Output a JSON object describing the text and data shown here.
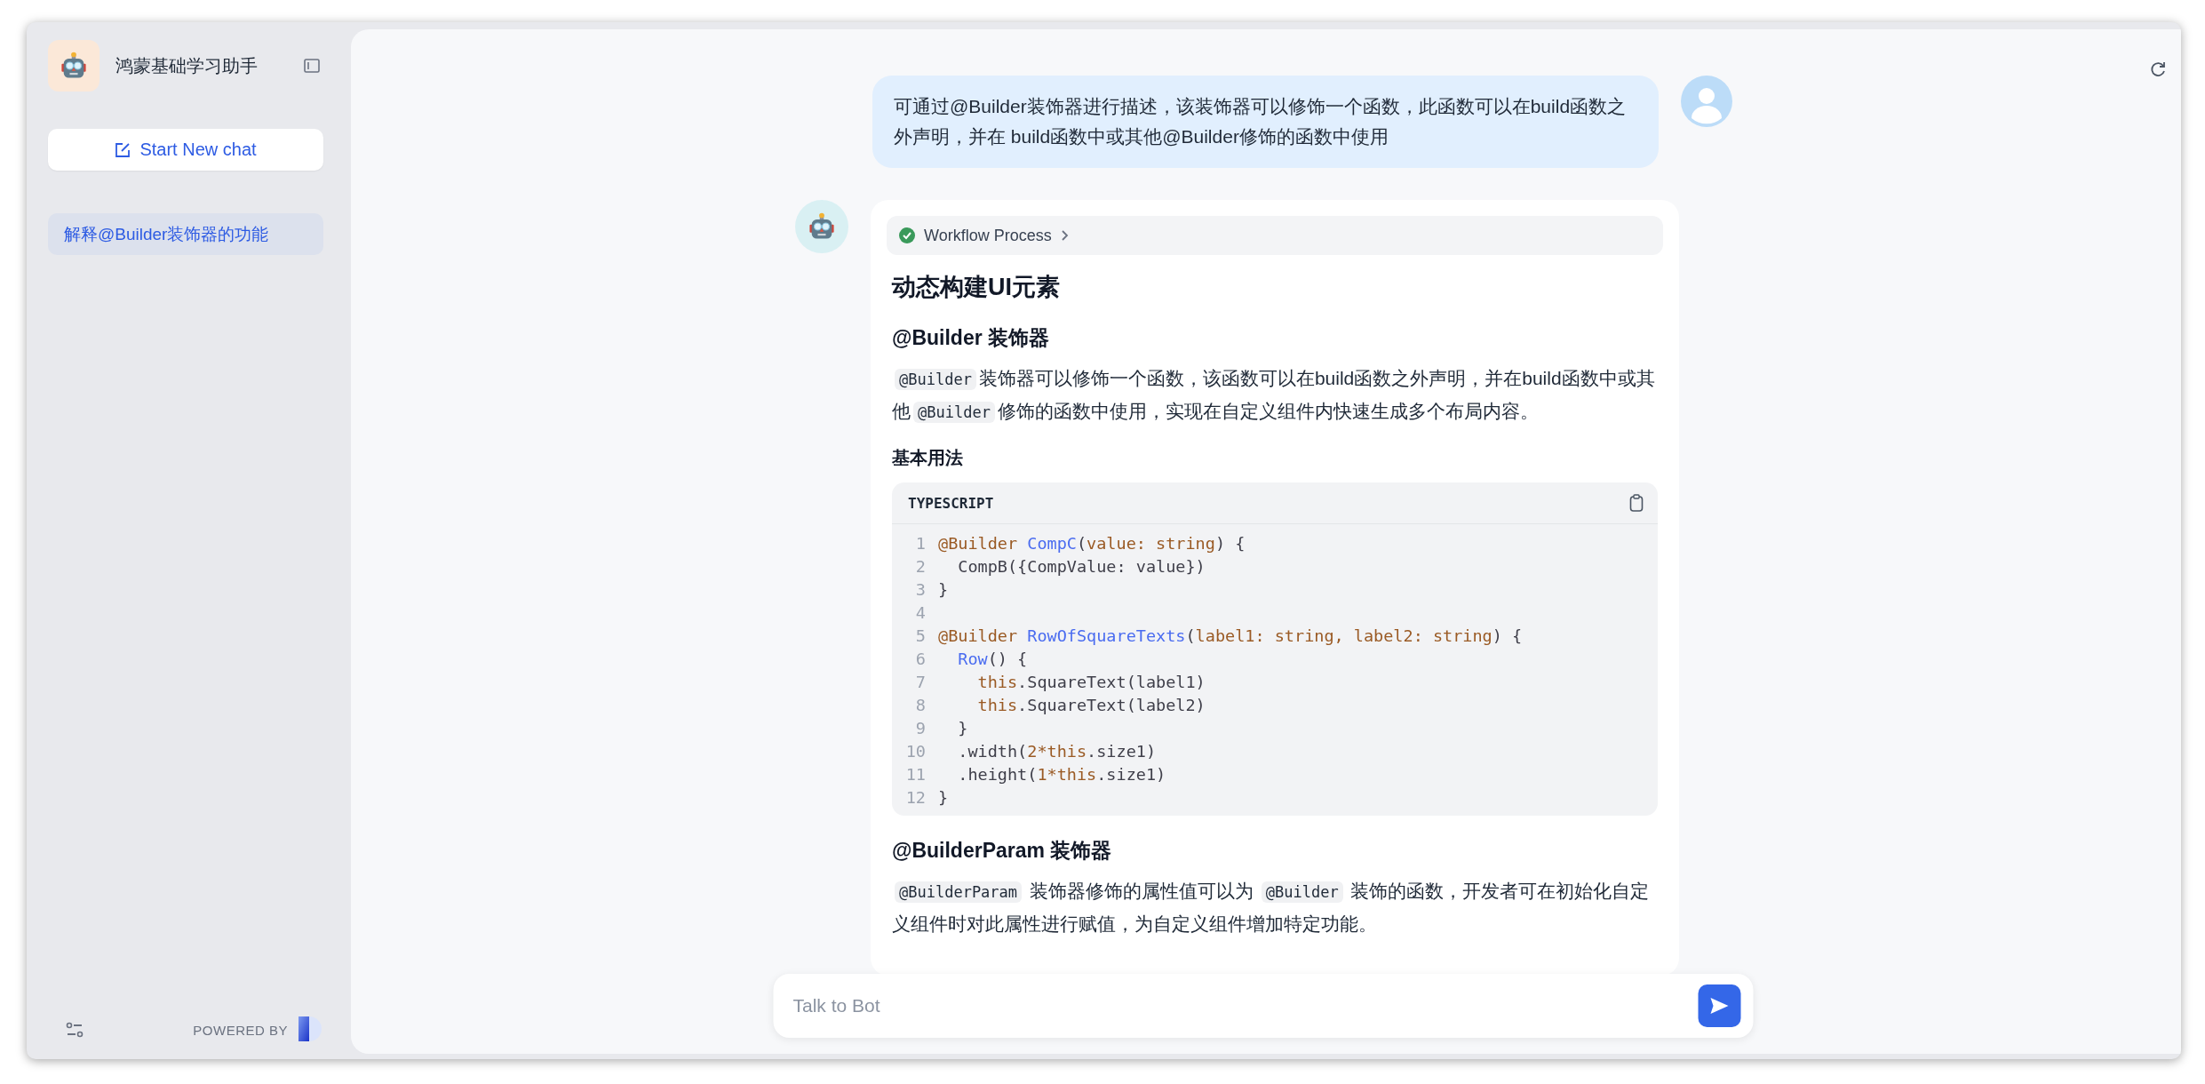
{
  "sidebar": {
    "title": "鸿蒙基础学习助手",
    "new_chat_button": "Start New chat",
    "conversations": [
      {
        "title": "解释@Builder装饰器的功能",
        "selected": true
      }
    ],
    "powered_by": "POWERED BY"
  },
  "messages": [
    {
      "kind": "user",
      "text": "可通过@Builder装饰器进行描述，该装饰器可以修饰一个函数，此函数可以在build函数之外声明，并在 build函数中或其他@Builder修饰的函数中使用"
    },
    {
      "kind": "bot",
      "workflow": {
        "label": "Workflow Process",
        "completed": true
      },
      "blocks": [
        {
          "kind": "h1",
          "text": "动态构建UI元素"
        },
        {
          "kind": "h2",
          "text": "@Builder 装饰器"
        },
        {
          "kind": "paragraph",
          "segments": [
            {
              "kind": "code",
              "text": "@Builder"
            },
            {
              "kind": "text",
              "text": "装饰器可以修饰一个函数，该函数可以在build函数之外声明，并在build函数中或其他"
            },
            {
              "kind": "code",
              "text": "@Builder"
            },
            {
              "kind": "text",
              "text": "修饰的函数中使用，实现在自定义组件内快速生成多个布局内容。"
            }
          ]
        },
        {
          "kind": "h3",
          "text": "基本用法"
        },
        {
          "kind": "code",
          "language": "TYPESCRIPT",
          "lines": [
            {
              "number": "1",
              "tokens": [
                {
                  "kind": "keyword",
                  "text": "@Builder"
                },
                {
                  "kind": "function",
                  "text": " CompC"
                },
                {
                  "kind": "plain",
                  "text": "("
                },
                {
                  "kind": "keyword",
                  "text": "value: string"
                },
                {
                  "kind": "plain",
                  "text": ") {"
                }
              ]
            },
            {
              "number": "2",
              "tokens": [
                {
                  "kind": "plain",
                  "text": "  CompB({CompValue: value})"
                }
              ]
            },
            {
              "number": "3",
              "tokens": [
                {
                  "kind": "plain",
                  "text": "}"
                }
              ]
            },
            {
              "number": "4"
            },
            {
              "number": "5",
              "tokens": [
                {
                  "kind": "keyword",
                  "text": "@Builder"
                },
                {
                  "kind": "function",
                  "text": " RowOfSquareTexts"
                },
                {
                  "kind": "plain",
                  "text": "("
                },
                {
                  "kind": "keyword",
                  "text": "label1: string, label2: string"
                },
                {
                  "kind": "plain",
                  "text": ") {"
                }
              ]
            },
            {
              "number": "6",
              "tokens": [
                {
                  "kind": "function",
                  "text": "  Row"
                },
                {
                  "kind": "plain",
                  "text": "() {"
                }
              ]
            },
            {
              "number": "7",
              "tokens": [
                {
                  "kind": "keyword",
                  "text": "    this"
                },
                {
                  "kind": "plain",
                  "text": ".SquareText(label1)"
                }
              ]
            },
            {
              "number": "8",
              "tokens": [
                {
                  "kind": "keyword",
                  "text": "    this"
                },
                {
                  "kind": "plain",
                  "text": ".SquareText(label2)"
                }
              ]
            },
            {
              "number": "9",
              "tokens": [
                {
                  "kind": "plain",
                  "text": "  }"
                }
              ]
            },
            {
              "number": "10",
              "tokens": [
                {
                  "kind": "plain",
                  "text": "  .width("
                },
                {
                  "kind": "keyword",
                  "text": "2*this"
                },
                {
                  "kind": "plain",
                  "text": ".size1)"
                }
              ]
            },
            {
              "number": "11",
              "tokens": [
                {
                  "kind": "plain",
                  "text": "  .height("
                },
                {
                  "kind": "keyword",
                  "text": "1*this"
                },
                {
                  "kind": "plain",
                  "text": ".size1)"
                }
              ]
            },
            {
              "number": "12",
              "tokens": [
                {
                  "kind": "plain",
                  "text": "}"
                }
              ]
            }
          ]
        },
        {
          "kind": "h2",
          "text": "@BuilderParam 装饰器"
        },
        {
          "kind": "paragraph",
          "segments": [
            {
              "kind": "code",
              "text": "@BuilderParam"
            },
            {
              "kind": "text",
              "text": " 装饰器修饰的属性值可以为 "
            },
            {
              "kind": "code",
              "text": "@Builder"
            },
            {
              "kind": "text",
              "text": " 装饰的函数，开发者可在初始化自定义组件时对此属性进行赋值，为自定义组件增加特定功能。"
            }
          ]
        }
      ]
    }
  ],
  "input": {
    "placeholder": "Talk to Bot"
  }
}
